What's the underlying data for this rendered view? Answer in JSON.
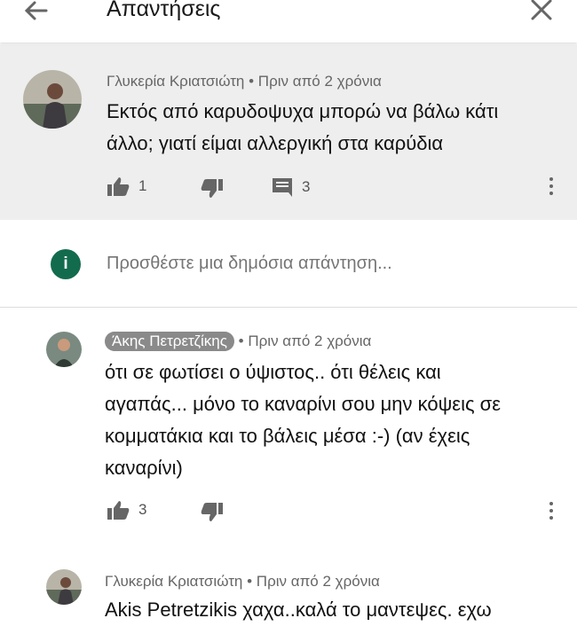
{
  "header": {
    "title": "Απαντήσεις"
  },
  "parent_comment": {
    "author": "Γλυκερία Κριατσιώτη",
    "time": "• Πριν από 2 χρόνια",
    "line1": "Εκτός από καρυδοψυχα μπορώ να βάλω κάτι",
    "line2": "άλλο; γιατί είμαι αλλεργική στα καρύδια",
    "likes": "1",
    "replies": "3"
  },
  "reply_box": {
    "avatar_letter": "i",
    "placeholder": "Προσθέστε μια δημόσια απάντηση..."
  },
  "replies": [
    {
      "author": "Άκης Πετρετζίκης",
      "time": "• Πριν από 2 χρόνια",
      "lines": [
        "ότι σε φωτίσει ο ύψιστος.. ότι θέλεις και",
        "αγαπάς... μόνο το καναρίνι σου μην κόψεις σε",
        "κομματάκια και το βάλεις μέσα :-) (αν έχεις",
        "καναρίνι)"
      ],
      "likes": "3"
    },
    {
      "author": "Γλυκερία Κριατσιώτη",
      "time": "• Πριν από 2 χρόνια",
      "line1": "Akis Petretzikis χαχα..καλά το μαντεψες. εχω"
    }
  ],
  "colors": {
    "accent_badge": "#136b4d",
    "highlight_bg": "#eeeeee"
  }
}
